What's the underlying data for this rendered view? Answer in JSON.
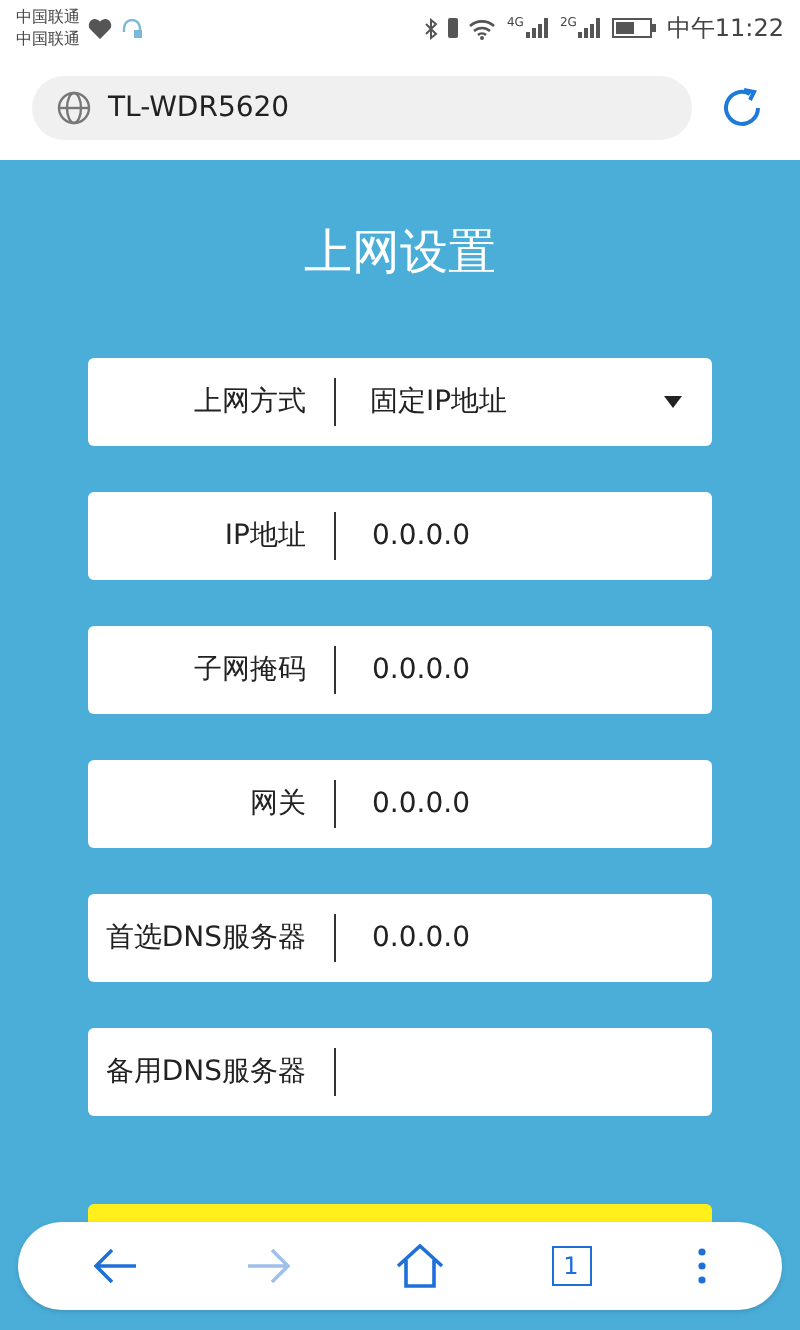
{
  "status_bar": {
    "carriers": [
      "中国联通",
      "中国联通"
    ],
    "network_labels": [
      "4G",
      "2G"
    ],
    "time": "中午11:22"
  },
  "address_bar": {
    "url": "TL-WDR5620"
  },
  "title": "上网设置",
  "fields": [
    {
      "kind": "select",
      "label": "上网方式",
      "value": "固定IP地址"
    },
    {
      "kind": "text",
      "label": "IP地址",
      "value": "0.0.0.0"
    },
    {
      "kind": "text",
      "label": "子网掩码",
      "value": "0.0.0.0"
    },
    {
      "kind": "text",
      "label": "网关",
      "value": "0.0.0.0"
    },
    {
      "kind": "text",
      "label": "首选DNS服务器",
      "value": "0.0.0.0"
    },
    {
      "kind": "text",
      "label": "备用DNS服务器"
    }
  ],
  "nav_bar": {
    "tab_count": "1",
    "forward_disabled": true
  }
}
